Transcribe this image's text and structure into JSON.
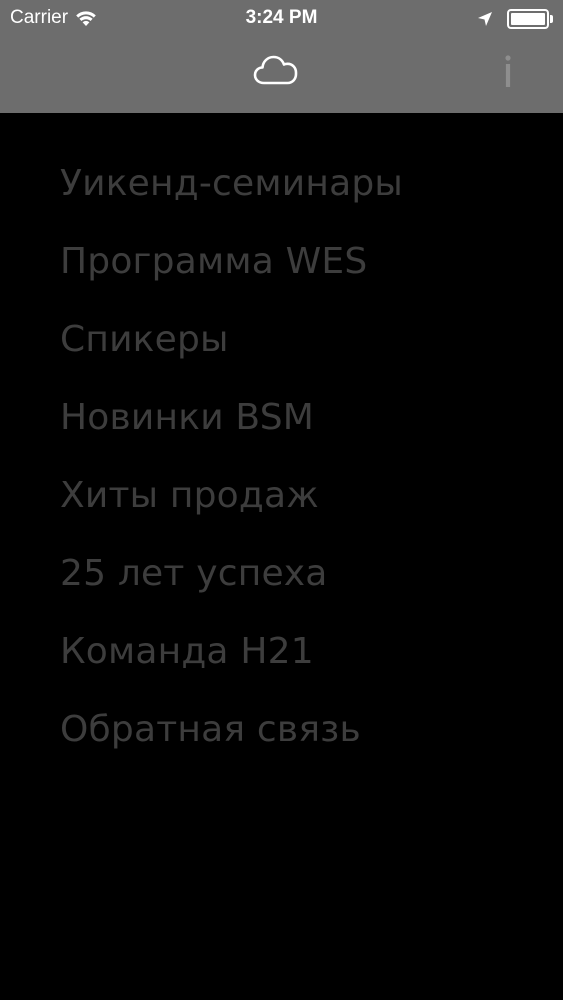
{
  "status_bar": {
    "carrier": "Carrier",
    "time": "3:24 PM",
    "battery_level": 1.0,
    "icons": [
      "wifi-icon",
      "location-arrow-icon",
      "battery-icon"
    ]
  },
  "nav_bar": {
    "left_icon": "cloud-icon",
    "right_icon": "info-icon",
    "background_color": "#6d6d6d"
  },
  "menu": {
    "text_color": "#3d3d3d",
    "items": [
      {
        "label": "Уикенд-семинары"
      },
      {
        "label": "Программа WES"
      },
      {
        "label": "Спикеры"
      },
      {
        "label": "Новинки BSM"
      },
      {
        "label": "Хиты продаж"
      },
      {
        "label": "25 лет успеха"
      },
      {
        "label": "Команда H21"
      },
      {
        "label": "Обратная связь"
      }
    ]
  }
}
